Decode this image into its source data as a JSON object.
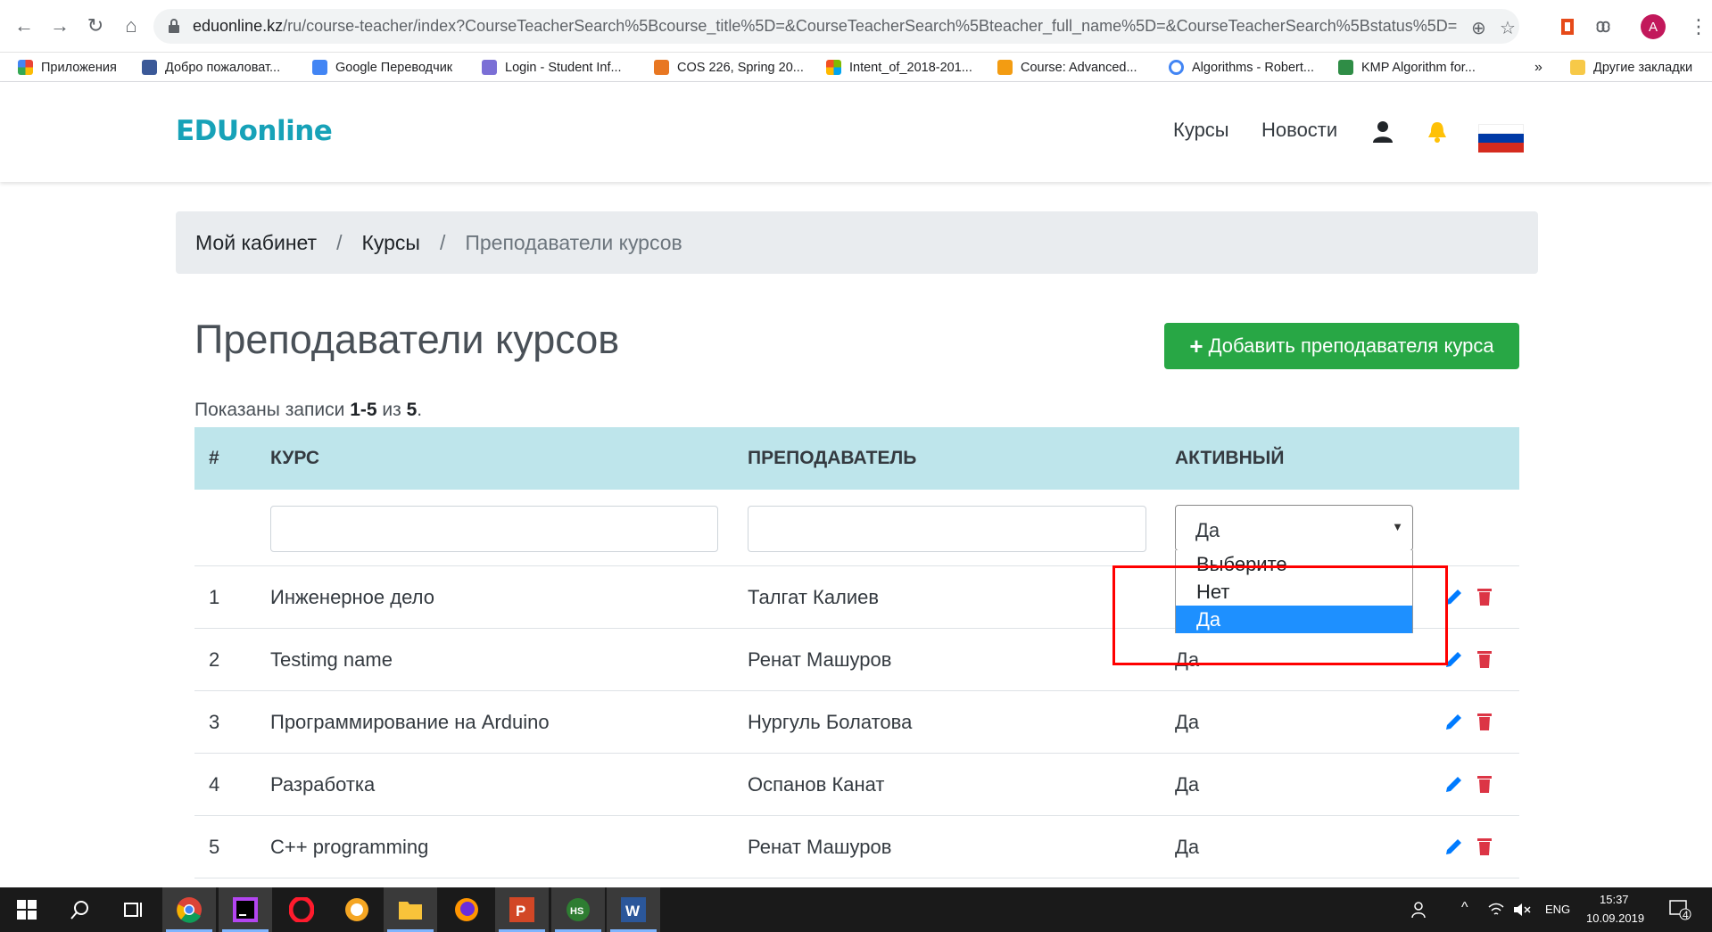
{
  "browser": {
    "url_host": "eduonline.kz",
    "url_path": "/ru/course-teacher/index?CourseTeacherSearch%5Bcourse_title%5D=&CourseTeacherSearch%5Bteacher_full_name%5D=&CourseTeacherSearch%5Bstatus%5D=",
    "avatar_letter": "A",
    "bookmarks": [
      {
        "label": "Приложения",
        "color": "#ea4335"
      },
      {
        "label": "Добро пожаловат...",
        "color": "#3b5998"
      },
      {
        "label": "Google Переводчик",
        "color": "#4285f4"
      },
      {
        "label": "Login - Student Inf...",
        "color": "#7b6fd6"
      },
      {
        "label": "COS 226, Spring 20...",
        "color": "#e87722"
      },
      {
        "label": "Intent_of_2018-201...",
        "color": "#f25022"
      },
      {
        "label": "Course: Advanced...",
        "color": "#f39c12"
      },
      {
        "label": "Algorithms - Robert...",
        "color": "#4285f4"
      },
      {
        "label": "KMP Algorithm for...",
        "color": "#2f8d46"
      }
    ],
    "more_bookmarks": "»",
    "other_bookmarks": "Другие закладки"
  },
  "site": {
    "brand": "EDUonline",
    "nav": {
      "courses": "Курсы",
      "news": "Новости"
    },
    "colors": {
      "brand": "#17a2b8",
      "success": "#28a745",
      "header_bg": "#bee5eb"
    }
  },
  "breadcrumb": {
    "items": [
      "Мой кабинет",
      "Курсы"
    ],
    "active": "Преподаватели курсов",
    "separator": "/"
  },
  "page": {
    "title": "Преподаватели курсов",
    "add_button": "Добавить преподавателя курса",
    "summary_prefix": "Показаны записи ",
    "summary_range": "1-5",
    "summary_of": " из ",
    "summary_total": "5",
    "summary_end": "."
  },
  "table": {
    "headers": {
      "num": "#",
      "course": "КУРС",
      "teacher": "ПРЕПОДАВАТЕЛЬ",
      "active": "АКТИВНЫЙ"
    },
    "filter": {
      "active_selected": "Да",
      "options": [
        "Выберите",
        "Нет",
        "Да"
      ]
    },
    "rows": [
      {
        "num": "1",
        "course": "Инженерное дело",
        "teacher": "Талгат Калиев",
        "active": ""
      },
      {
        "num": "2",
        "course": "Testimg name",
        "teacher": "Ренат Машуров",
        "active": "Да"
      },
      {
        "num": "3",
        "course": "Программирование на Arduino",
        "teacher": "Нургуль Болатова",
        "active": "Да"
      },
      {
        "num": "4",
        "course": "Разработка",
        "teacher": "Оспанов Канат",
        "active": "Да"
      },
      {
        "num": "5",
        "course": "C++ programming",
        "teacher": "Ренат Машуров",
        "active": "Да"
      }
    ]
  },
  "taskbar": {
    "lang": "ENG",
    "time": "15:37",
    "date": "10.09.2019",
    "notif_count": "4"
  }
}
